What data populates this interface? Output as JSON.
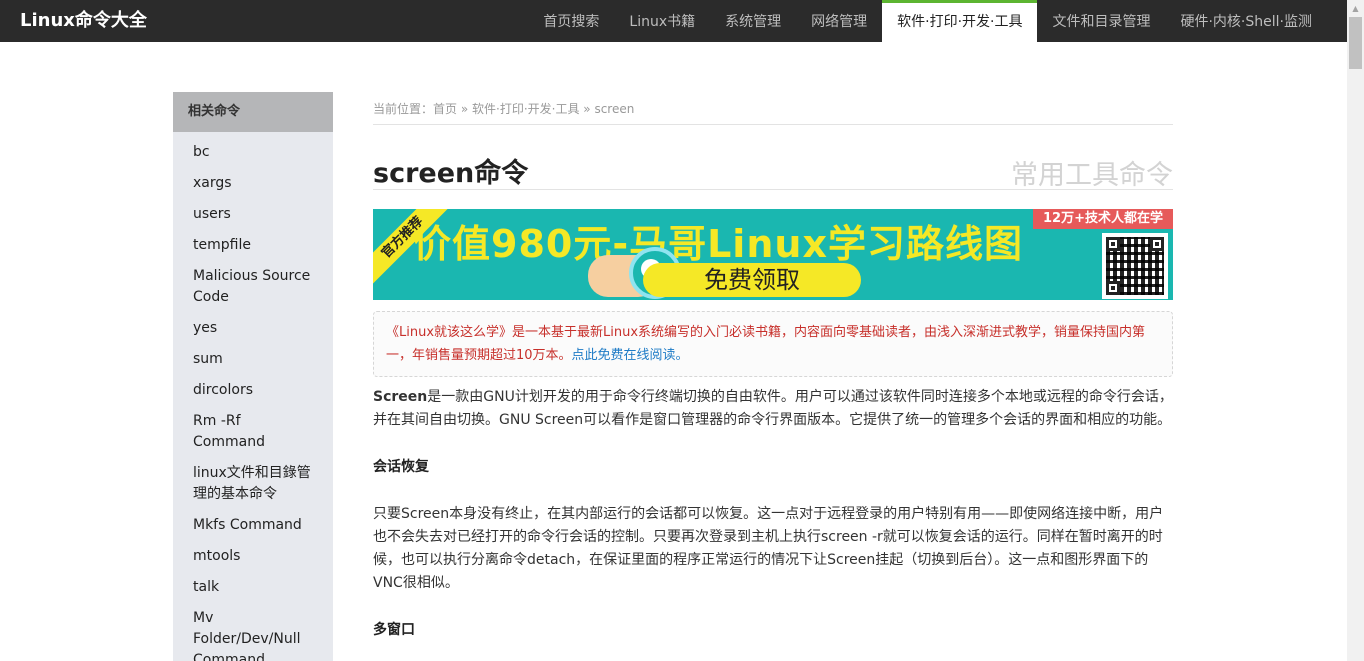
{
  "header": {
    "logo": "Linux命令大全",
    "nav": [
      {
        "label": "首页搜索",
        "active": false
      },
      {
        "label": "Linux书籍",
        "active": false
      },
      {
        "label": "系统管理",
        "active": false
      },
      {
        "label": "网络管理",
        "active": false
      },
      {
        "label": "软件·打印·开发·工具",
        "active": true
      },
      {
        "label": "文件和目录管理",
        "active": false
      },
      {
        "label": "硬件·内核·Shell·监测",
        "active": false
      }
    ]
  },
  "sidebar": {
    "heading": "相关命令",
    "items": [
      "bc",
      "xargs",
      "users",
      "tempfile",
      "Malicious Source Code",
      "yes",
      "sum",
      "dircolors",
      "Rm -Rf Command",
      "linux文件和目錄管理的基本命令",
      "Mkfs Command",
      "mtools",
      "talk",
      "Mv Folder/Dev/Null Command"
    ]
  },
  "breadcrumb": {
    "prefix": "当前位置：",
    "home": "首页",
    "sep1": " » ",
    "category": "软件·打印·开发·工具",
    "sep2": " » ",
    "current": "screen"
  },
  "page": {
    "title": "screen命令",
    "subtitle": "常用工具命令"
  },
  "banner": {
    "ribbon": "官方推荐",
    "headline": "价值980元-马哥Linux学习路线图",
    "tag": "12万+技术人都在学",
    "button": "免费领取"
  },
  "notice": {
    "text": "《Linux就该这么学》是一本基于最新Linux系统编写的入门必读书籍，内容面向零基础读者，由浅入深渐进式教学，销量保持国内第一，年销售量预期超过10万本。",
    "link": "点此免费在线阅读。"
  },
  "content": {
    "intro_bold": "Screen",
    "intro": "是一款由GNU计划开发的用于命令行终端切换的自由软件。用户可以通过该软件同时连接多个本地或远程的命令行会话，并在其间自由切换。GNU Screen可以看作是窗口管理器的命令行界面版本。它提供了统一的管理多个会话的界面和相应的功能。",
    "section1_title": "会话恢复",
    "section1_text": "只要Screen本身没有终止，在其内部运行的会话都可以恢复。这一点对于远程登录的用户特别有用——即使网络连接中断，用户也不会失去对已经打开的命令行会话的控制。只要再次登录到主机上执行screen -r就可以恢复会话的运行。同样在暂时离开的时候，也可以执行分离命令detach，在保证里面的程序正常运行的情况下让Screen挂起（切换到后台）。这一点和图形界面下的VNC很相似。",
    "section2_title": "多窗口"
  },
  "colors": {
    "topbar": "#2b2b2b",
    "active_accent": "#5cb531",
    "sidebar_bg": "#e7e9ee",
    "banner_bg": "#1ab7b0",
    "notice_text": "#c7302b",
    "link": "#1e7bc6"
  }
}
